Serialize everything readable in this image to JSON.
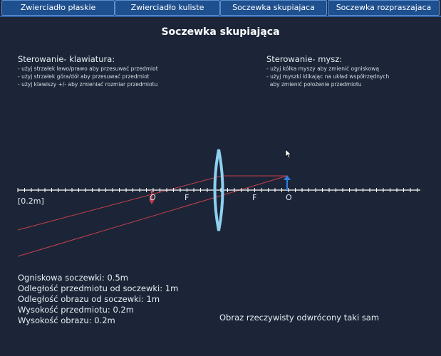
{
  "tabs": [
    {
      "label": "Zwierciadło płaskie"
    },
    {
      "label": "Zwierciadło kuliste"
    },
    {
      "label": "Soczewka skupiajaca"
    },
    {
      "label": "Soczewka rozpraszajaca"
    }
  ],
  "title": "Soczewka skupiająca",
  "keyboard": {
    "heading": "Sterowanie- klawiatura:",
    "lines": [
      "- użyj strzałek lewo/prawo aby przesuwać przedmiot",
      "- użyj strzałek góra/dół aby przesuwać przedmiot",
      "- użyj klawiszy +/- aby zmieniać rozmiar przedmiotu"
    ]
  },
  "mouse": {
    "heading": "Sterowanie- mysz:",
    "lines": [
      "- użyj kółka myszy aby zmienić ogniskową",
      "- użyj myszki klikając na układ współrzędnych",
      "  aby zmienić położenie przedmiotu"
    ]
  },
  "axis": {
    "scale_label": "[0.2m]",
    "labels": [
      "O",
      "F",
      "F",
      "O"
    ]
  },
  "info": [
    "Ogniskowa soczewki: 0.5m",
    "Odległość przedmiotu od soczewki: 1m",
    "Odległość obrazu od soczewki: 1m",
    "Wysokość przedmiotu: 0.2m",
    "Wysokość obrazu: 0.2m"
  ],
  "result": "Obraz  rzeczywisty odwrócony taki sam",
  "colors": {
    "background": "#1b2537",
    "tab": "#1e4f8e",
    "lens": "#8fd0f0",
    "object_arrow": "#2f7fe0",
    "image_arrow": "#c8404a",
    "rays": "#c8404a",
    "axis": "#ffffff"
  }
}
